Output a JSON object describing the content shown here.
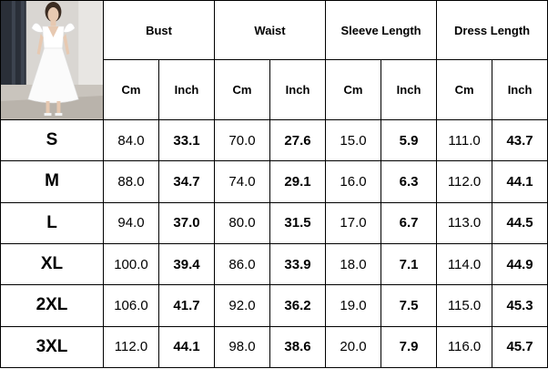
{
  "photo_icon": "white-dress-photo",
  "headers": [
    "Bust",
    "Waist",
    "Sleeve Length",
    "Dress Length"
  ],
  "units": {
    "cm": "Cm",
    "inch": "Inch"
  },
  "rows": [
    {
      "size": "S",
      "values": [
        "84.0",
        "33.1",
        "70.0",
        "27.6",
        "15.0",
        "5.9",
        "111.0",
        "43.7"
      ]
    },
    {
      "size": "M",
      "values": [
        "88.0",
        "34.7",
        "74.0",
        "29.1",
        "16.0",
        "6.3",
        "112.0",
        "44.1"
      ]
    },
    {
      "size": "L",
      "values": [
        "94.0",
        "37.0",
        "80.0",
        "31.5",
        "17.0",
        "6.7",
        "113.0",
        "44.5"
      ]
    },
    {
      "size": "XL",
      "values": [
        "100.0",
        "39.4",
        "86.0",
        "33.9",
        "18.0",
        "7.1",
        "114.0",
        "44.9"
      ]
    },
    {
      "size": "2XL",
      "values": [
        "106.0",
        "41.7",
        "92.0",
        "36.2",
        "19.0",
        "7.5",
        "115.0",
        "45.3"
      ]
    },
    {
      "size": "3XL",
      "values": [
        "112.0",
        "44.1",
        "98.0",
        "38.6",
        "20.0",
        "7.9",
        "116.0",
        "45.7"
      ]
    }
  ]
}
